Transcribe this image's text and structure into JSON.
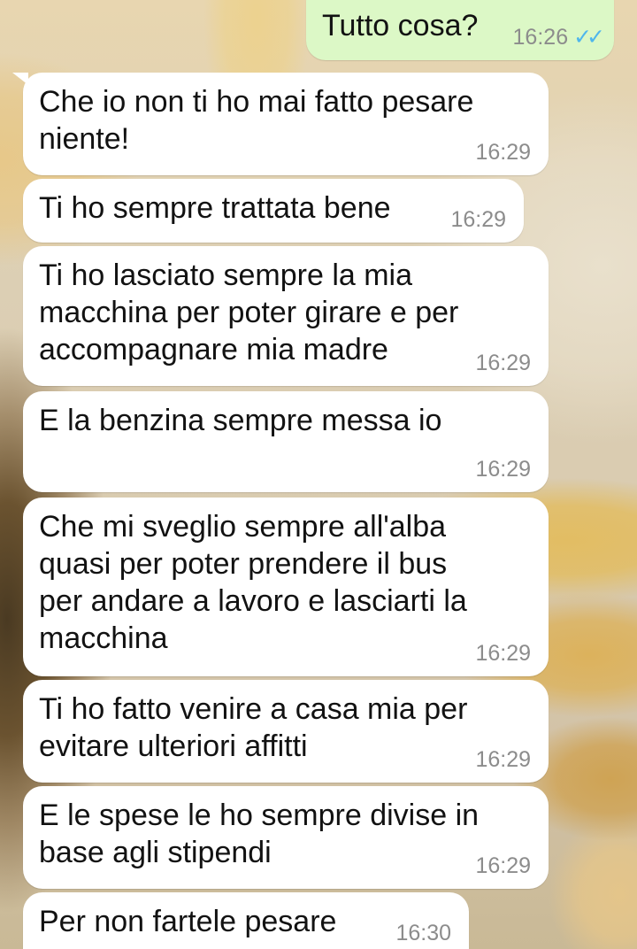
{
  "colors": {
    "incoming_bubble": "#ffffff",
    "outgoing_bubble": "#dcf8c6",
    "timestamp": "#8c8c8c",
    "read_ticks": "#4fb6ec"
  },
  "messages": [
    {
      "direction": "outgoing",
      "text": "Tutto cosa?",
      "time": "16:26",
      "status_icon": "double-check-read-icon"
    },
    {
      "direction": "incoming",
      "text": "Che io non ti ho mai fatto pesare\nniente!",
      "time": "16:29"
    },
    {
      "direction": "incoming",
      "text": "Ti ho sempre trattata bene",
      "time": "16:29"
    },
    {
      "direction": "incoming",
      "text": "Ti ho lasciato sempre la mia\nmacchina per poter girare e per\naccompagnare mia madre",
      "time": "16:29"
    },
    {
      "direction": "incoming",
      "text": "E la benzina sempre messa io",
      "time": "16:29"
    },
    {
      "direction": "incoming",
      "text": "Che mi sveglio sempre all'alba\nquasi per poter prendere il bus\nper andare a lavoro e lasciarti la\nmacchina",
      "time": "16:29"
    },
    {
      "direction": "incoming",
      "text": "Ti ho fatto venire a casa mia per\nevitare ulteriori affitti",
      "time": "16:29"
    },
    {
      "direction": "incoming",
      "text": "E le spese le ho sempre divise in\nbase agli stipendi",
      "time": "16:29"
    },
    {
      "direction": "incoming",
      "text": "Per non fartele pesare",
      "time": "16:30"
    }
  ]
}
